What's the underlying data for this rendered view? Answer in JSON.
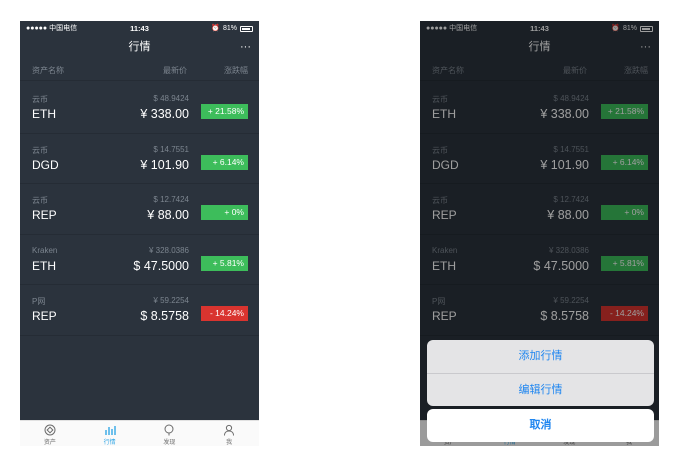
{
  "status": {
    "carrier": "●●●●● 中国电信",
    "time": "11:43",
    "battery": "81%"
  },
  "nav": {
    "title": "行情",
    "more": "···"
  },
  "columns": {
    "name": "资产名称",
    "price": "最新价",
    "change": "涨跌幅"
  },
  "rows": [
    {
      "exchange": "云币",
      "symbol": "ETH",
      "sub_price": "$ 48.9424",
      "price": "¥ 338.00",
      "change": "+ 21.58%",
      "direction": "up"
    },
    {
      "exchange": "云币",
      "symbol": "DGD",
      "sub_price": "$ 14.7551",
      "price": "¥ 101.90",
      "change": "+ 6.14%",
      "direction": "up"
    },
    {
      "exchange": "云币",
      "symbol": "REP",
      "sub_price": "$ 12.7424",
      "price": "¥ 88.00",
      "change": "+ 0%",
      "direction": "up"
    },
    {
      "exchange": "Kraken",
      "symbol": "ETH",
      "sub_price": "¥ 328.0386",
      "price": "$ 47.5000",
      "change": "+ 5.81%",
      "direction": "up"
    },
    {
      "exchange": "P网",
      "symbol": "REP",
      "sub_price": "¥ 59.2254",
      "price": "$ 8.5758",
      "change": "- 14.24%",
      "direction": "down"
    }
  ],
  "tabs": [
    {
      "label": "资产",
      "icon": "assets-icon"
    },
    {
      "label": "行情",
      "icon": "market-chart-icon"
    },
    {
      "label": "发现",
      "icon": "discover-icon"
    },
    {
      "label": "我",
      "icon": "profile-icon"
    }
  ],
  "action_sheet": {
    "add": "添加行情",
    "edit": "编辑行情",
    "cancel": "取消"
  },
  "colors": {
    "background": "#2b333d",
    "up": "#3dbd5b",
    "down": "#d9342f",
    "accent": "#33a7e6",
    "sheet_text": "#1f86f0"
  }
}
